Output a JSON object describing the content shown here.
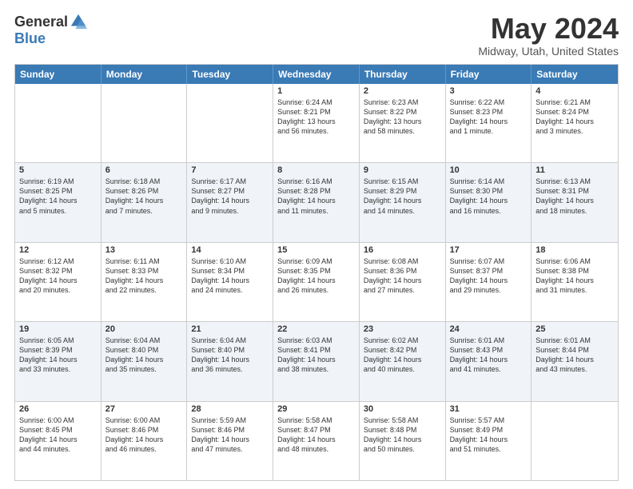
{
  "header": {
    "logo_general": "General",
    "logo_blue": "Blue",
    "month_title": "May 2024",
    "location": "Midway, Utah, United States"
  },
  "days_of_week": [
    "Sunday",
    "Monday",
    "Tuesday",
    "Wednesday",
    "Thursday",
    "Friday",
    "Saturday"
  ],
  "rows": [
    {
      "alt": false,
      "cells": [
        {
          "empty": true
        },
        {
          "empty": true
        },
        {
          "empty": true
        },
        {
          "day": "1",
          "lines": [
            "Sunrise: 6:24 AM",
            "Sunset: 8:21 PM",
            "Daylight: 13 hours",
            "and 56 minutes."
          ]
        },
        {
          "day": "2",
          "lines": [
            "Sunrise: 6:23 AM",
            "Sunset: 8:22 PM",
            "Daylight: 13 hours",
            "and 58 minutes."
          ]
        },
        {
          "day": "3",
          "lines": [
            "Sunrise: 6:22 AM",
            "Sunset: 8:23 PM",
            "Daylight: 14 hours",
            "and 1 minute."
          ]
        },
        {
          "day": "4",
          "lines": [
            "Sunrise: 6:21 AM",
            "Sunset: 8:24 PM",
            "Daylight: 14 hours",
            "and 3 minutes."
          ]
        }
      ]
    },
    {
      "alt": true,
      "cells": [
        {
          "day": "5",
          "lines": [
            "Sunrise: 6:19 AM",
            "Sunset: 8:25 PM",
            "Daylight: 14 hours",
            "and 5 minutes."
          ]
        },
        {
          "day": "6",
          "lines": [
            "Sunrise: 6:18 AM",
            "Sunset: 8:26 PM",
            "Daylight: 14 hours",
            "and 7 minutes."
          ]
        },
        {
          "day": "7",
          "lines": [
            "Sunrise: 6:17 AM",
            "Sunset: 8:27 PM",
            "Daylight: 14 hours",
            "and 9 minutes."
          ]
        },
        {
          "day": "8",
          "lines": [
            "Sunrise: 6:16 AM",
            "Sunset: 8:28 PM",
            "Daylight: 14 hours",
            "and 11 minutes."
          ]
        },
        {
          "day": "9",
          "lines": [
            "Sunrise: 6:15 AM",
            "Sunset: 8:29 PM",
            "Daylight: 14 hours",
            "and 14 minutes."
          ]
        },
        {
          "day": "10",
          "lines": [
            "Sunrise: 6:14 AM",
            "Sunset: 8:30 PM",
            "Daylight: 14 hours",
            "and 16 minutes."
          ]
        },
        {
          "day": "11",
          "lines": [
            "Sunrise: 6:13 AM",
            "Sunset: 8:31 PM",
            "Daylight: 14 hours",
            "and 18 minutes."
          ]
        }
      ]
    },
    {
      "alt": false,
      "cells": [
        {
          "day": "12",
          "lines": [
            "Sunrise: 6:12 AM",
            "Sunset: 8:32 PM",
            "Daylight: 14 hours",
            "and 20 minutes."
          ]
        },
        {
          "day": "13",
          "lines": [
            "Sunrise: 6:11 AM",
            "Sunset: 8:33 PM",
            "Daylight: 14 hours",
            "and 22 minutes."
          ]
        },
        {
          "day": "14",
          "lines": [
            "Sunrise: 6:10 AM",
            "Sunset: 8:34 PM",
            "Daylight: 14 hours",
            "and 24 minutes."
          ]
        },
        {
          "day": "15",
          "lines": [
            "Sunrise: 6:09 AM",
            "Sunset: 8:35 PM",
            "Daylight: 14 hours",
            "and 26 minutes."
          ]
        },
        {
          "day": "16",
          "lines": [
            "Sunrise: 6:08 AM",
            "Sunset: 8:36 PM",
            "Daylight: 14 hours",
            "and 27 minutes."
          ]
        },
        {
          "day": "17",
          "lines": [
            "Sunrise: 6:07 AM",
            "Sunset: 8:37 PM",
            "Daylight: 14 hours",
            "and 29 minutes."
          ]
        },
        {
          "day": "18",
          "lines": [
            "Sunrise: 6:06 AM",
            "Sunset: 8:38 PM",
            "Daylight: 14 hours",
            "and 31 minutes."
          ]
        }
      ]
    },
    {
      "alt": true,
      "cells": [
        {
          "day": "19",
          "lines": [
            "Sunrise: 6:05 AM",
            "Sunset: 8:39 PM",
            "Daylight: 14 hours",
            "and 33 minutes."
          ]
        },
        {
          "day": "20",
          "lines": [
            "Sunrise: 6:04 AM",
            "Sunset: 8:40 PM",
            "Daylight: 14 hours",
            "and 35 minutes."
          ]
        },
        {
          "day": "21",
          "lines": [
            "Sunrise: 6:04 AM",
            "Sunset: 8:40 PM",
            "Daylight: 14 hours",
            "and 36 minutes."
          ]
        },
        {
          "day": "22",
          "lines": [
            "Sunrise: 6:03 AM",
            "Sunset: 8:41 PM",
            "Daylight: 14 hours",
            "and 38 minutes."
          ]
        },
        {
          "day": "23",
          "lines": [
            "Sunrise: 6:02 AM",
            "Sunset: 8:42 PM",
            "Daylight: 14 hours",
            "and 40 minutes."
          ]
        },
        {
          "day": "24",
          "lines": [
            "Sunrise: 6:01 AM",
            "Sunset: 8:43 PM",
            "Daylight: 14 hours",
            "and 41 minutes."
          ]
        },
        {
          "day": "25",
          "lines": [
            "Sunrise: 6:01 AM",
            "Sunset: 8:44 PM",
            "Daylight: 14 hours",
            "and 43 minutes."
          ]
        }
      ]
    },
    {
      "alt": false,
      "cells": [
        {
          "day": "26",
          "lines": [
            "Sunrise: 6:00 AM",
            "Sunset: 8:45 PM",
            "Daylight: 14 hours",
            "and 44 minutes."
          ]
        },
        {
          "day": "27",
          "lines": [
            "Sunrise: 6:00 AM",
            "Sunset: 8:46 PM",
            "Daylight: 14 hours",
            "and 46 minutes."
          ]
        },
        {
          "day": "28",
          "lines": [
            "Sunrise: 5:59 AM",
            "Sunset: 8:46 PM",
            "Daylight: 14 hours",
            "and 47 minutes."
          ]
        },
        {
          "day": "29",
          "lines": [
            "Sunrise: 5:58 AM",
            "Sunset: 8:47 PM",
            "Daylight: 14 hours",
            "and 48 minutes."
          ]
        },
        {
          "day": "30",
          "lines": [
            "Sunrise: 5:58 AM",
            "Sunset: 8:48 PM",
            "Daylight: 14 hours",
            "and 50 minutes."
          ]
        },
        {
          "day": "31",
          "lines": [
            "Sunrise: 5:57 AM",
            "Sunset: 8:49 PM",
            "Daylight: 14 hours",
            "and 51 minutes."
          ]
        },
        {
          "empty": true
        }
      ]
    }
  ]
}
